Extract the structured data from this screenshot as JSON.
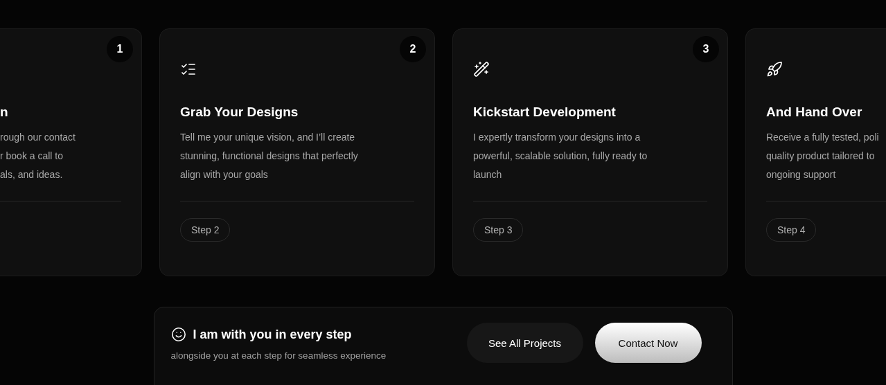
{
  "cards": [
    {
      "kind": "cut-left",
      "number": "1",
      "title": "n",
      "lines": [
        "rough our contact",
        "r book a call to",
        "als, and ideas."
      ]
    },
    {
      "kind": "whole",
      "number": "2",
      "title": "Grab Your Designs",
      "lines": [
        "Tell me your unique vision, and I’ll create",
        "stunning, functional designs that perfectly",
        "align with your goals"
      ],
      "step": "Step 2"
    },
    {
      "kind": "whole",
      "number": "3",
      "title": "Kickstart Development",
      "lines": [
        "I expertly transform your designs into a",
        "powerful, scalable solution, fully ready to",
        "launch"
      ],
      "step": "Step 3"
    },
    {
      "kind": "cut-right",
      "title": "And Hand Over",
      "lines": [
        "Receive a fully tested, poli",
        "quality product tailored to",
        "ongoing support"
      ],
      "step": "Step 4"
    }
  ],
  "banner": {
    "heading": "I am with you in every step",
    "subtext": "alongside you at each step for seamless experience",
    "buttons": [
      {
        "kind": "secondary",
        "label": "See All Projects"
      },
      {
        "kind": "primary",
        "label": "Contact Now"
      }
    ]
  }
}
